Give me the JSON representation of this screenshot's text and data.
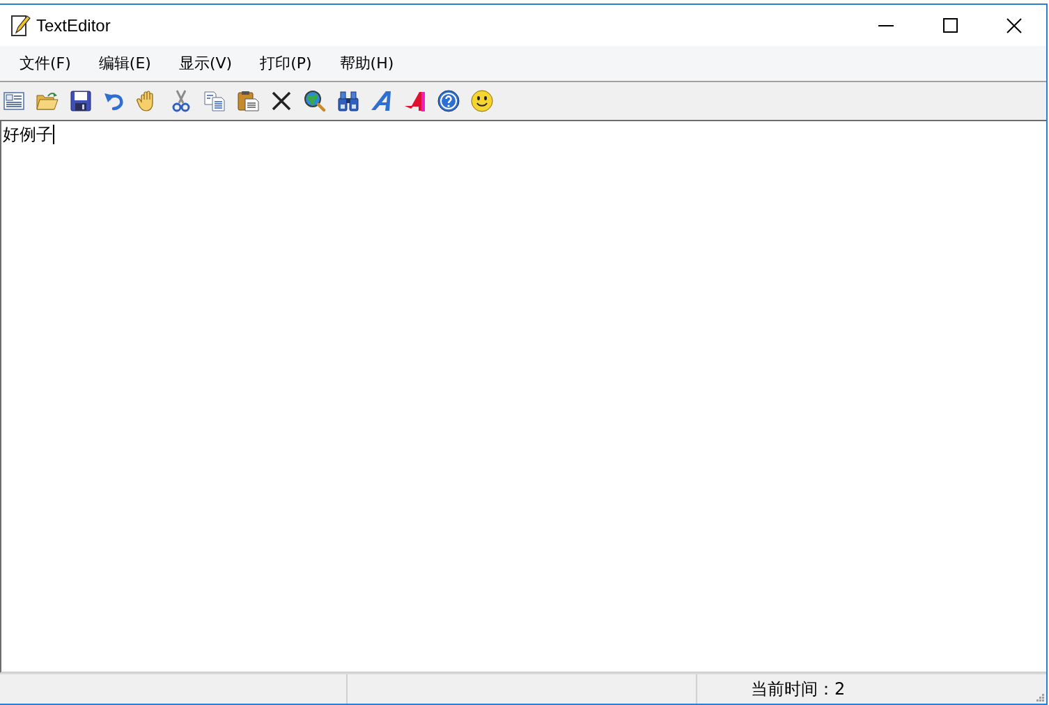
{
  "window": {
    "title": "TextEditor"
  },
  "menu": [
    {
      "label": "文件(F)"
    },
    {
      "label": "编辑(E)"
    },
    {
      "label": "显示(V)"
    },
    {
      "label": "打印(P)"
    },
    {
      "label": "帮助(H)"
    }
  ],
  "editor": {
    "text": "好例子",
    "focused": true
  },
  "status_bar": {
    "clock_text": "当前时间：2"
  }
}
